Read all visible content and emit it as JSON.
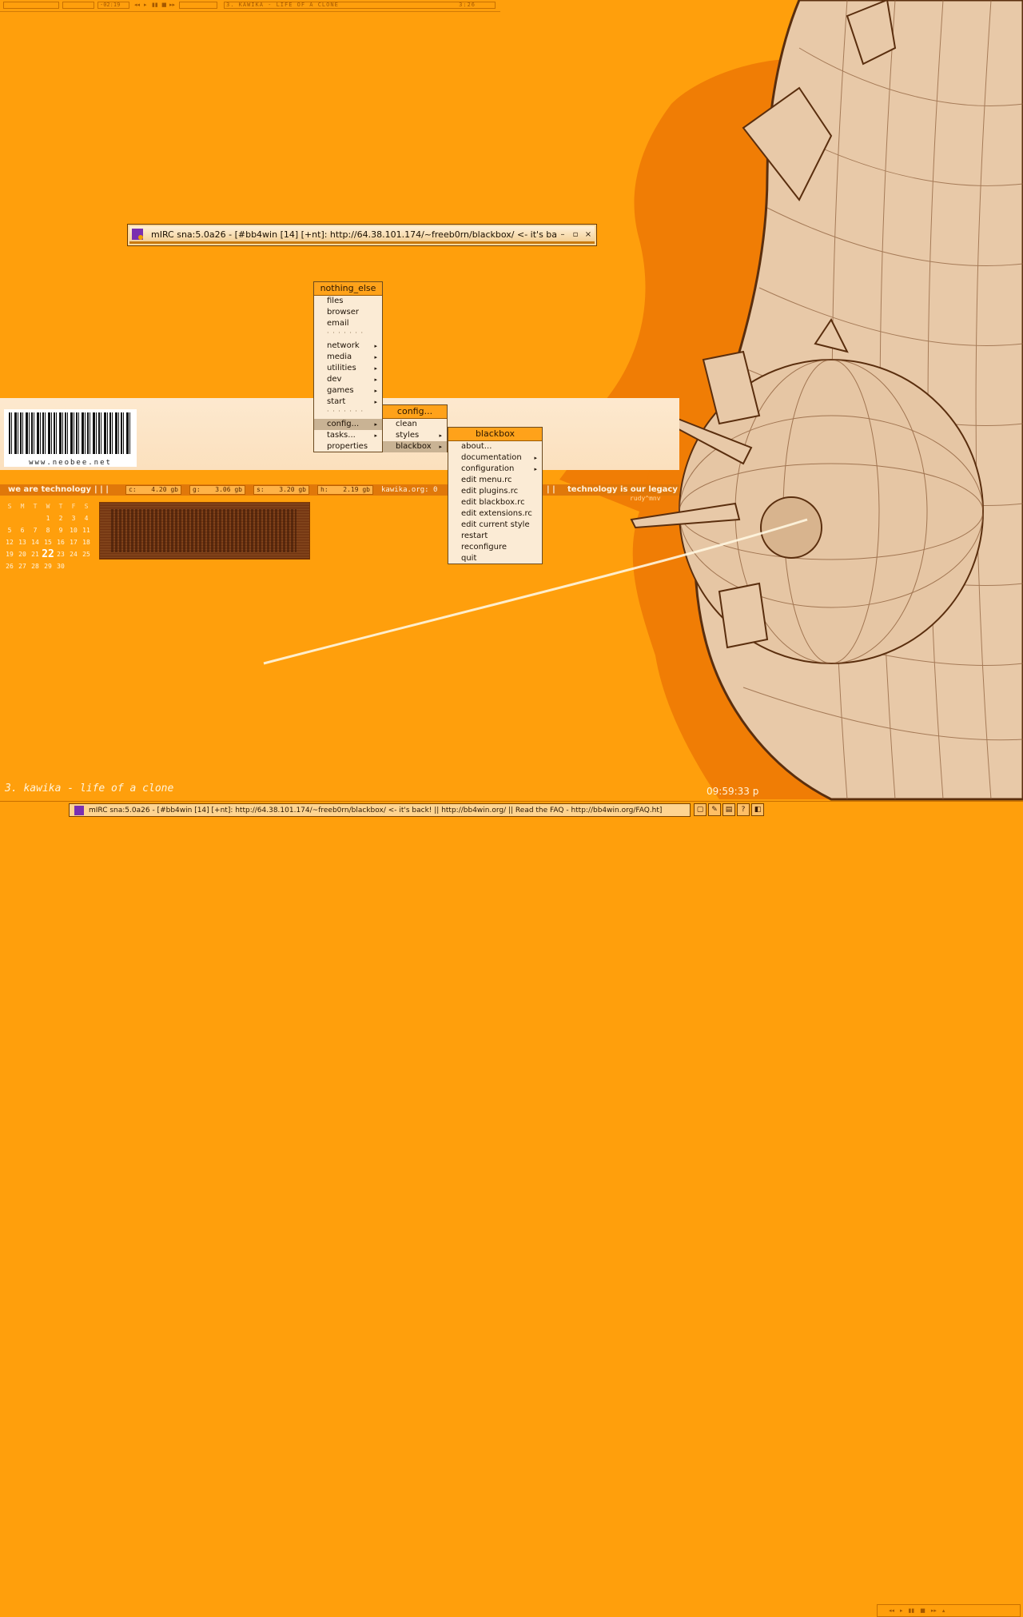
{
  "topbar": {
    "track_field": "",
    "time_field": "-02:19",
    "now_playing": "3. KAWIKA - LIFE OF A CLONE",
    "track_time": "3:26",
    "controls": [
      "◂◂",
      "▸",
      "▮▮",
      "■",
      "▸▸"
    ]
  },
  "mirc_window": {
    "title": "mIRC sna:5.0a26 - [#bb4win [14] [+nt]: http://64.38.101.174/~freeb0rn/blackbox/ <- it's ba...",
    "minimize": "–",
    "restore": "▫",
    "close": "×"
  },
  "root_menu": {
    "title": "nothing_else",
    "items": [
      {
        "label": "files"
      },
      {
        "label": "browser"
      },
      {
        "label": "email"
      },
      {
        "label": "network",
        "submenu": true
      },
      {
        "label": "media",
        "submenu": true
      },
      {
        "label": "utilities",
        "submenu": true
      },
      {
        "label": "dev",
        "submenu": true
      },
      {
        "label": "games",
        "submenu": true
      },
      {
        "label": "start",
        "submenu": true
      },
      {
        "label": "config...",
        "submenu": true,
        "selected": true
      },
      {
        "label": "tasks...",
        "submenu": true
      },
      {
        "label": "properties"
      }
    ],
    "separator": "· · · · · · ·"
  },
  "config_menu": {
    "title": "config...",
    "items": [
      {
        "label": "clean"
      },
      {
        "label": "styles",
        "submenu": true
      },
      {
        "label": "blackbox",
        "submenu": true,
        "selected": true
      }
    ]
  },
  "blackbox_menu": {
    "title": "blackbox",
    "items": [
      {
        "label": "about..."
      },
      {
        "label": "documentation",
        "submenu": true
      },
      {
        "label": "configuration",
        "submenu": true
      },
      {
        "label": "edit menu.rc"
      },
      {
        "label": "edit plugins.rc"
      },
      {
        "label": "edit blackbox.rc"
      },
      {
        "label": "edit extensions.rc"
      },
      {
        "label": "edit current style"
      },
      {
        "label": "restart"
      },
      {
        "label": "reconfigure"
      },
      {
        "label": "quit"
      }
    ]
  },
  "desktop": {
    "barcode_url": "www.neobee.net",
    "slogan_left": "we are technology",
    "slogan_right": "technology is our legacy",
    "signature": "rudy^mnv",
    "pipes": "|  |  |",
    "pipes_right": "|  |",
    "drives": [
      {
        "letter": "c:",
        "size": "4.20 gb"
      },
      {
        "letter": "g:",
        "size": "3.06 gb"
      },
      {
        "letter": "s:",
        "size": "3.20 gb"
      },
      {
        "letter": "h:",
        "size": "2.19 gb"
      }
    ],
    "host_label": "kawika.org: 0",
    "song_title": "3. kawika - life of a clone",
    "clock": "09:59:33 p"
  },
  "calendar": {
    "headers": [
      "S",
      "M",
      "T",
      "W",
      "T",
      "F",
      "S"
    ],
    "weeks": [
      [
        "",
        "",
        "",
        "1",
        "2",
        "3",
        "4"
      ],
      [
        "5",
        "6",
        "7",
        "8",
        "9",
        "10",
        "11"
      ],
      [
        "12",
        "13",
        "14",
        "15",
        "16",
        "17",
        "18"
      ],
      [
        "19",
        "20",
        "21",
        "22",
        "23",
        "24",
        "25"
      ],
      [
        "26",
        "27",
        "28",
        "29",
        "30",
        "",
        ""
      ]
    ],
    "today": "22"
  },
  "taskbar": {
    "task_title": "mIRC sna:5.0a26 - [#bb4win [14] [+nt]: http://64.38.101.174/~freeb0rn/blackbox/ <- it's back! || http://bb4win.org/ || Read the FAQ - http://bb4win.org/FAQ.ht]",
    "tray_icons": [
      "window-icon",
      "pen-icon",
      "image-icon",
      "help-icon",
      "exit-icon"
    ],
    "mini_controls": [
      "◂◂",
      "▸",
      "▮▮",
      "■",
      "▸▸",
      "▴"
    ]
  },
  "colors": {
    "background": "#ff9f0c",
    "menu_bg": "#fbebd5",
    "menu_title": "#ffa21a",
    "menu_selected": "#c9b394",
    "planet": "#e8c9a8"
  }
}
